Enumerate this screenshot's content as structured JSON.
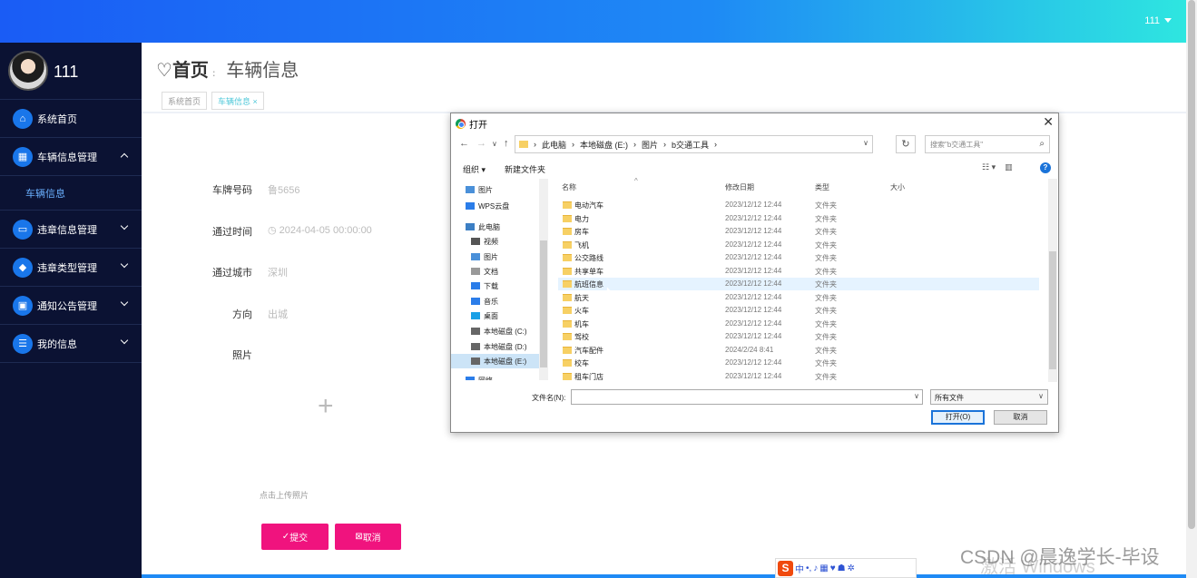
{
  "topbar": {
    "user": "111"
  },
  "sidebar": {
    "username": "111",
    "items": [
      {
        "label": "系统首页",
        "icon": "home-icon"
      },
      {
        "label": "车辆信息管理",
        "icon": "grid-icon",
        "expanded": true
      },
      {
        "label": "车辆信息",
        "sub": true
      },
      {
        "label": "违章信息管理",
        "icon": "message-icon"
      },
      {
        "label": "违章类型管理",
        "icon": "tag-icon"
      },
      {
        "label": "通知公告管理",
        "icon": "bag-icon"
      },
      {
        "label": "我的信息",
        "icon": "profile-icon"
      }
    ]
  },
  "header": {
    "home": "首页",
    "page": "车辆信息"
  },
  "tags": [
    "系统首页",
    "车辆信息 ×"
  ],
  "form": {
    "plate_label": "车牌号码",
    "plate_value": "鲁5656",
    "time_label": "通过时间",
    "time_value": "2024-04-05 00:00:00",
    "city_label": "通过城市",
    "city_value": "深圳",
    "direction_label": "方向",
    "direction_value": "出城",
    "photo_label": "照片",
    "upload_hint": "点击上传照片",
    "submit": "提交",
    "cancel": "取消"
  },
  "dialog": {
    "title": "打开",
    "breadcrumb": [
      "此电脑",
      "本地磁盘 (E:)",
      "图片",
      "b交通工具"
    ],
    "search_placeholder": "搜索\"b交通工具\"",
    "organize": "组织 ▾",
    "new_folder": "新建文件夹",
    "nav": [
      {
        "label": "图片",
        "icon": "pictures-icon"
      },
      {
        "label": "WPS云盘",
        "icon": "cloud-icon"
      },
      {
        "label": "此电脑",
        "icon": "computer-icon"
      },
      {
        "label": "视频",
        "icon": "video-icon"
      },
      {
        "label": "图片",
        "icon": "pictures-icon"
      },
      {
        "label": "文档",
        "icon": "document-icon"
      },
      {
        "label": "下载",
        "icon": "download-icon"
      },
      {
        "label": "音乐",
        "icon": "music-icon"
      },
      {
        "label": "桌面",
        "icon": "desktop-icon"
      },
      {
        "label": "本地磁盘 (C:)",
        "icon": "drive-icon"
      },
      {
        "label": "本地磁盘 (D:)",
        "icon": "drive-icon"
      },
      {
        "label": "本地磁盘 (E:)",
        "icon": "drive-icon",
        "selected": true
      },
      {
        "label": "网络",
        "icon": "network-icon"
      }
    ],
    "columns": {
      "name": "名称",
      "date": "修改日期",
      "type": "类型",
      "size": "大小"
    },
    "files": [
      {
        "name": "电动汽车",
        "date": "2023/12/12 12:44",
        "type": "文件夹"
      },
      {
        "name": "电力",
        "date": "2023/12/12 12:44",
        "type": "文件夹"
      },
      {
        "name": "房车",
        "date": "2023/12/12 12:44",
        "type": "文件夹"
      },
      {
        "name": "飞机",
        "date": "2023/12/12 12:44",
        "type": "文件夹"
      },
      {
        "name": "公交路线",
        "date": "2023/12/12 12:44",
        "type": "文件夹"
      },
      {
        "name": "共享单车",
        "date": "2023/12/12 12:44",
        "type": "文件夹"
      },
      {
        "name": "航班信息",
        "date": "2023/12/12 12:44",
        "type": "文件夹",
        "hover": true
      },
      {
        "name": "航天",
        "date": "2023/12/12 12:44",
        "type": "文件夹"
      },
      {
        "name": "火车",
        "date": "2023/12/12 12:44",
        "type": "文件夹"
      },
      {
        "name": "机车",
        "date": "2023/12/12 12:44",
        "type": "文件夹"
      },
      {
        "name": "驾校",
        "date": "2023/12/12 12:44",
        "type": "文件夹"
      },
      {
        "name": "汽车配件",
        "date": "2024/2/24 8:41",
        "type": "文件夹"
      },
      {
        "name": "校车",
        "date": "2023/12/12 12:44",
        "type": "文件夹"
      },
      {
        "name": "租车门店",
        "date": "2023/12/12 12:44",
        "type": "文件夹"
      }
    ],
    "filename_label": "文件名(N):",
    "filename_value": "",
    "filetype": "所有文件",
    "open": "打开(O)",
    "cancel": "取消"
  },
  "ime": {
    "label": "中"
  },
  "watermark": "CSDN @晨逸学长-毕设",
  "win_activation": "激活 Windows"
}
